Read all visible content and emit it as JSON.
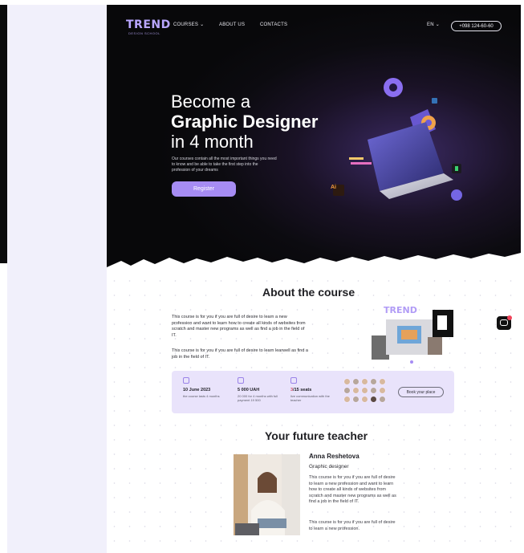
{
  "nav": {
    "logo": "TREND",
    "logo_sub": "DESIGN SCHOOL",
    "courses": "COURSES",
    "about": "ABOUT US",
    "contacts": "CONTACTS",
    "lang": "EN",
    "phone": "+098 124-60-60"
  },
  "hero": {
    "title_line1": "Become a",
    "title_line2": "Graphic Designer",
    "title_line3": "in 4 month",
    "description": "Our courses contain all the most important things you need to know and be able to take the first step into the profession of your dreams",
    "register_label": "Register"
  },
  "about": {
    "title": "About the course",
    "paragraph1": "This course is for you if you are full of desire to learn a new profession and want to learn how to create all kinds of websites from scratch and master new programs as well as find a job in the field of IT.",
    "paragraph2": "This course is for you if you are full of desire to learn learwell as find a job in the field of IT.",
    "image_label": "TREND"
  },
  "info": {
    "date_main": "10 June 2023",
    "date_sub": "the course lasts 4 months",
    "price_main": "5 000 UAH",
    "price_sub": "20 000 for 4 months with full payment 19 500",
    "seats_taken": "3",
    "seats_rest": "/15 seats",
    "seats_sub": "live communication with the teacher",
    "book_label": "Book your place"
  },
  "teacher": {
    "title": "Your future teacher",
    "name": "Anna Reshetova",
    "role": "Graphic designer",
    "paragraph1": "This course is for you if you are full of desire to learn a new profession and want to learn how to create all kinds of websites from scratch and master new programs as well as find a job in the field of IT.",
    "paragraph2": "This course is for you if you are full of desire to learn a new profession."
  },
  "colors": {
    "accent": "#a68cf3",
    "card": "#e9e3fb",
    "hero_dark": "#0c0b10",
    "alert": "#f0435a"
  }
}
